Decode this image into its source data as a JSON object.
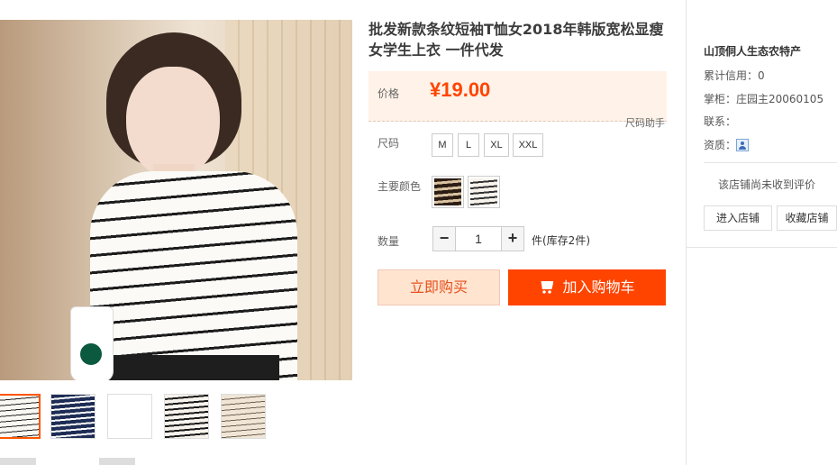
{
  "product": {
    "title": "批发新款条纹短袖T恤女2018年韩版宽松显瘦女学生上衣 一件代发",
    "price_label": "价格",
    "price_value": "¥19.00",
    "size_assist": "尺码助手"
  },
  "options": {
    "size_label": "尺码",
    "sizes": [
      "M",
      "L",
      "XL",
      "XXL"
    ],
    "color_label": "主要颜色",
    "colors": [
      "stripe-dark",
      "stripe-white"
    ],
    "qty_label": "数量",
    "qty_value": "1",
    "stock_text": "件(库存2件)"
  },
  "actions": {
    "buy_now": "立即购买",
    "add_cart": "加入购物车"
  },
  "store": {
    "name": "山顶侗人生态农特产",
    "credit": "累计信用：0",
    "keeper": "掌柜：庄园主20060105",
    "contact": "联系：",
    "qualification": "资质：",
    "no_review": "该店铺尚未收到评价",
    "enter_store": "进入店铺",
    "favorite_store": "收藏店铺"
  },
  "colors": {
    "accent": "#ff4400",
    "buy_bg": "#ffe4d0",
    "price_bg": "#fff2e8"
  }
}
